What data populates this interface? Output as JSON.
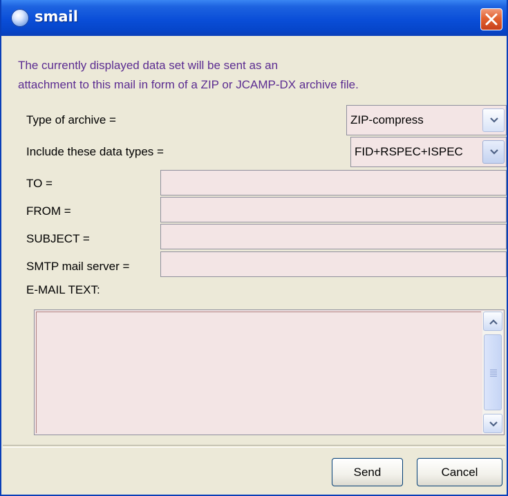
{
  "window": {
    "title": "smail"
  },
  "description": {
    "line1": "The currently displayed data set will be sent as an",
    "line2": "attachment to this mail in form of a ZIP or JCAMP-DX archive file."
  },
  "archive": {
    "label": "Type of archive =",
    "value": "ZIP-compress"
  },
  "datatypes": {
    "label": "Include these data types =",
    "value": "FID+RSPEC+ISPEC"
  },
  "to": {
    "label": "TO =",
    "value": ""
  },
  "from": {
    "label": "FROM =",
    "value": ""
  },
  "subject": {
    "label": "SUBJECT =",
    "value": ""
  },
  "smtp": {
    "label": "SMTP mail server =",
    "value": ""
  },
  "email_text": {
    "label": "E-MAIL TEXT:",
    "value": ""
  },
  "buttons": {
    "send": "Send",
    "cancel": "Cancel"
  },
  "colors": {
    "titlebar": "#0a4ed8",
    "field_bg": "#f3e5e5",
    "description_text": "#5b2c91",
    "dialog_bg": "#ece9d8",
    "close_button": "#e2612f"
  },
  "icons": {
    "app": "globe-icon",
    "close": "close-icon"
  }
}
